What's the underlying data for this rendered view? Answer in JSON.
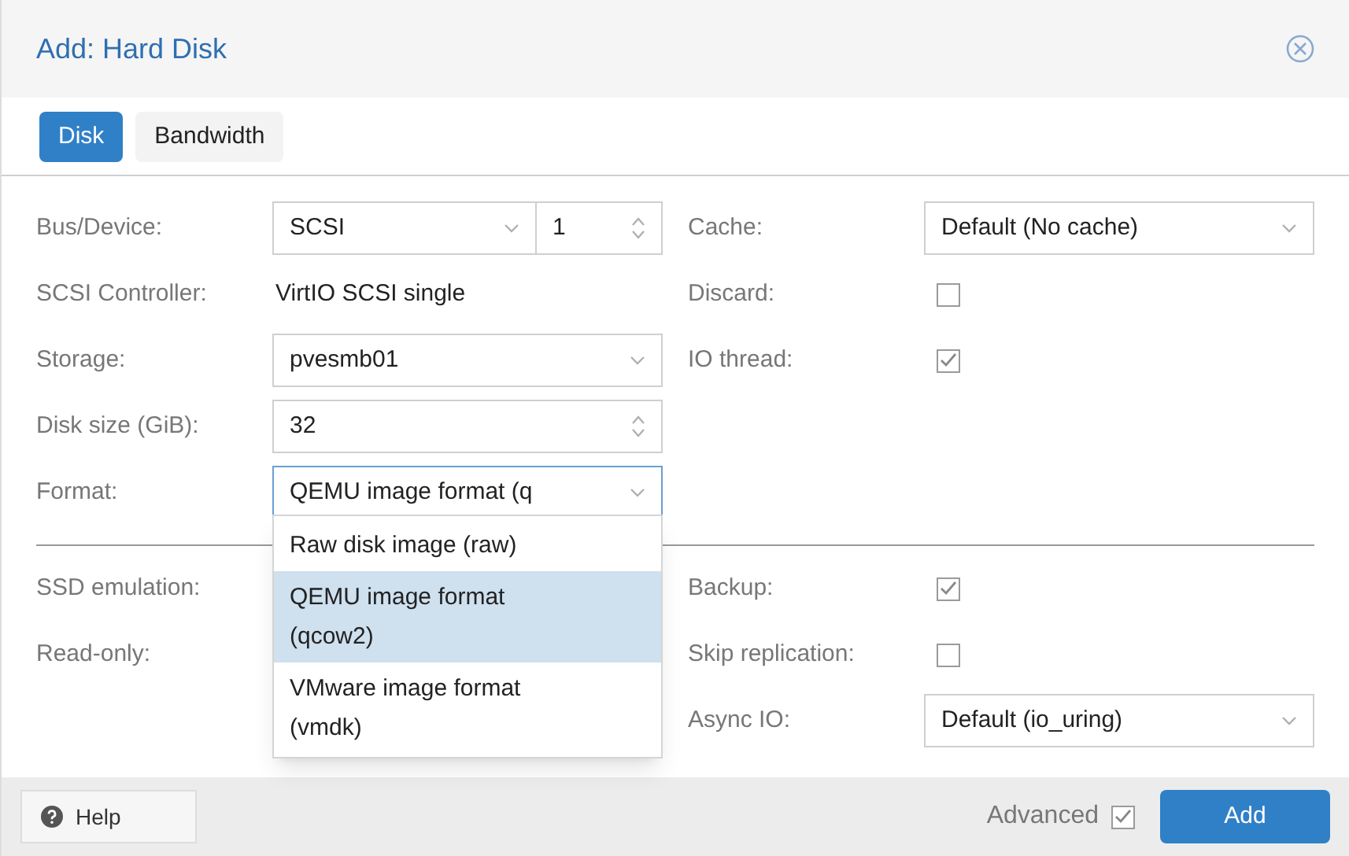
{
  "window": {
    "title": "Add: Hard Disk"
  },
  "tabs": [
    {
      "label": "Disk",
      "selected": true
    },
    {
      "label": "Bandwidth",
      "selected": false
    }
  ],
  "left_fields": [
    {
      "kind": "bus",
      "label": "Bus/Device:",
      "value": "SCSI",
      "number": "1"
    },
    {
      "kind": "text",
      "label": "SCSI Controller:",
      "value": "VirtIO SCSI single"
    },
    {
      "kind": "select",
      "label": "Storage:",
      "value": "pvesmb01"
    },
    {
      "kind": "spinner",
      "label": "Disk size (GiB):",
      "value": "32"
    },
    {
      "kind": "select",
      "label": "Format:",
      "value": "QEMU image format (q",
      "focused": true
    }
  ],
  "right_fields": [
    {
      "kind": "select",
      "label": "Cache:",
      "value": "Default (No cache)"
    },
    {
      "kind": "checkbox",
      "label": "Discard:",
      "checked": false
    },
    {
      "kind": "checkbox",
      "label": "IO thread:",
      "checked": true
    }
  ],
  "advanced_left": [
    {
      "label": "SSD emulation:"
    },
    {
      "label": "Read-only:"
    }
  ],
  "advanced_right": [
    {
      "kind": "checkbox",
      "label": "Backup:",
      "checked": true
    },
    {
      "kind": "checkbox",
      "label": "Skip replication:",
      "checked": false
    },
    {
      "kind": "select",
      "label": "Async IO:",
      "value": "Default (io_uring)"
    }
  ],
  "format_dropdown": {
    "options": [
      {
        "label": "Raw disk image (raw)",
        "selected": false
      },
      {
        "label": "QEMU image format (qcow2)",
        "selected": true
      },
      {
        "label": "VMware image format (vmdk)",
        "selected": false
      }
    ]
  },
  "footer": {
    "help": "Help",
    "advanced": {
      "label": "Advanced",
      "checked": true
    },
    "add": "Add"
  }
}
